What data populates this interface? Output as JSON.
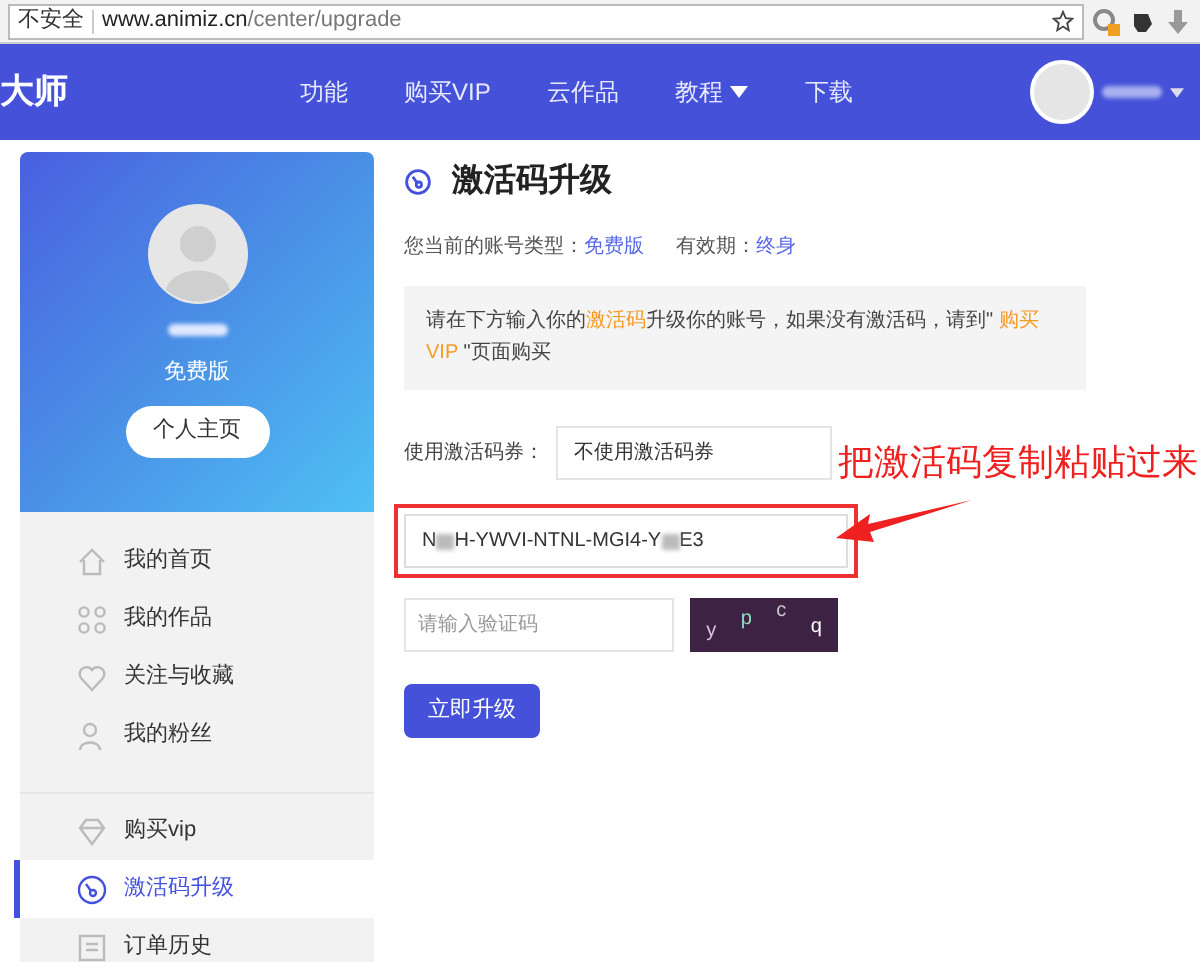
{
  "browser": {
    "security_label": "不安全",
    "url_host": "www.animiz.cn",
    "url_path": "/center/upgrade"
  },
  "nav": {
    "logo": "大师",
    "items": [
      {
        "label": "功能",
        "has_menu": false
      },
      {
        "label": "购买VIP",
        "has_menu": false
      },
      {
        "label": "云作品",
        "has_menu": false
      },
      {
        "label": "教程",
        "has_menu": true
      },
      {
        "label": "下载",
        "has_menu": false
      }
    ]
  },
  "profile": {
    "plan": "免费版",
    "home_button": "个人主页"
  },
  "sidebar": {
    "groups": [
      [
        {
          "label": "我的首页",
          "selected": false
        },
        {
          "label": "我的作品",
          "selected": false
        },
        {
          "label": "关注与收藏",
          "selected": false
        },
        {
          "label": "我的粉丝",
          "selected": false
        }
      ],
      [
        {
          "label": "购买vip",
          "selected": false
        },
        {
          "label": "激活码升级",
          "selected": true
        },
        {
          "label": "订单历史",
          "selected": false
        }
      ]
    ]
  },
  "page": {
    "title": "激活码升级",
    "account_type_label": "您当前的账号类型：",
    "account_type": "免费版",
    "validity_label": "有效期：",
    "validity": "终身",
    "notice": "请在下方输入你的**激活码**升级你的账号，如果没有激活码，请到\" **购买VIP** \"页面购买",
    "coupon_label": "使用激活码券：",
    "coupon_value": "不使用激活码券",
    "code_parts": [
      "N",
      "H-YWVI-NTNL-MGI4-Y",
      "E3"
    ],
    "captcha_placeholder": "请输入验证码",
    "captcha_chars": [
      "y",
      "p",
      "c",
      "q"
    ],
    "submit": "立即升级"
  },
  "annotation": {
    "text": "把激活码复制粘贴过来"
  }
}
